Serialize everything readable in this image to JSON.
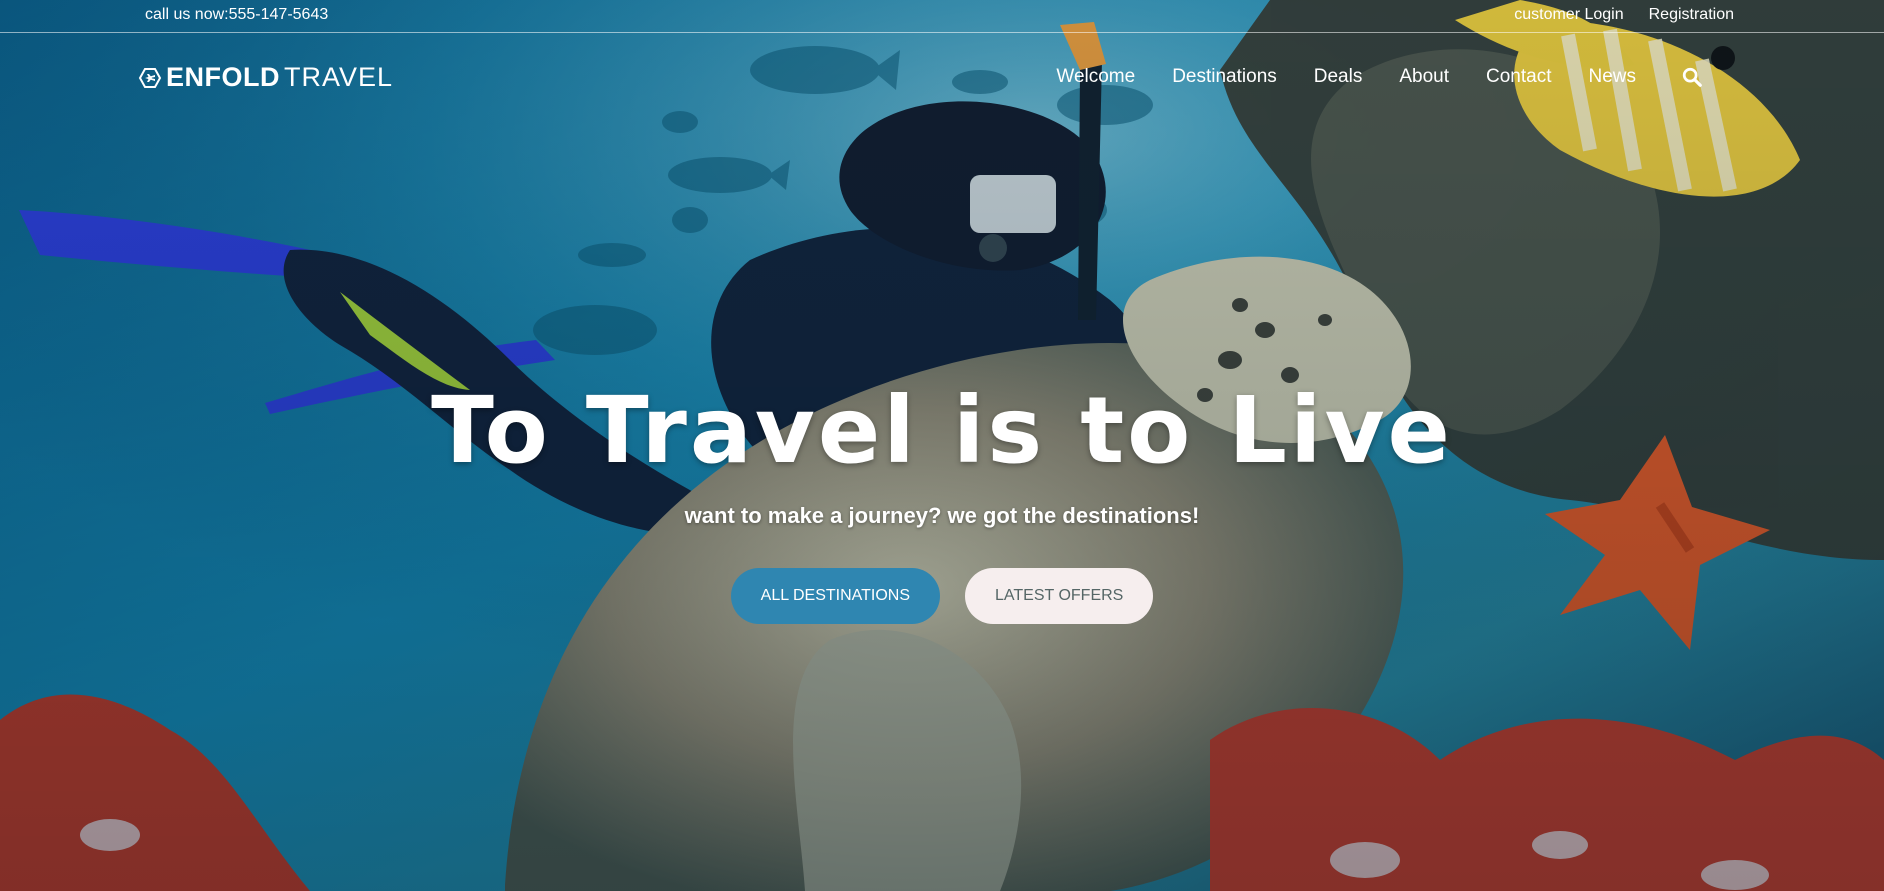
{
  "topbar": {
    "phone_text": "call us now:555-147-5643",
    "links": [
      {
        "label": "customer Login"
      },
      {
        "label": "Registration"
      }
    ]
  },
  "brand": {
    "name_strong": "ENFOLD",
    "name_light": "TRAVEL",
    "icon": "airplane-badge-icon"
  },
  "nav": {
    "items": [
      {
        "label": "Welcome"
      },
      {
        "label": "Destinations"
      },
      {
        "label": "Deals"
      },
      {
        "label": "About"
      },
      {
        "label": "Contact"
      },
      {
        "label": "News"
      }
    ],
    "search_icon": "search-icon"
  },
  "hero": {
    "title": "To Travel is to Live",
    "subtitle": "want to make a journey? we got the destinations!",
    "primary_button": "ALL DESTINATIONS",
    "secondary_button": "LATEST OFFERS"
  },
  "colors": {
    "primary_button": "#2f86b1",
    "secondary_button": "#f6eeee",
    "text_light": "#ffffff"
  }
}
